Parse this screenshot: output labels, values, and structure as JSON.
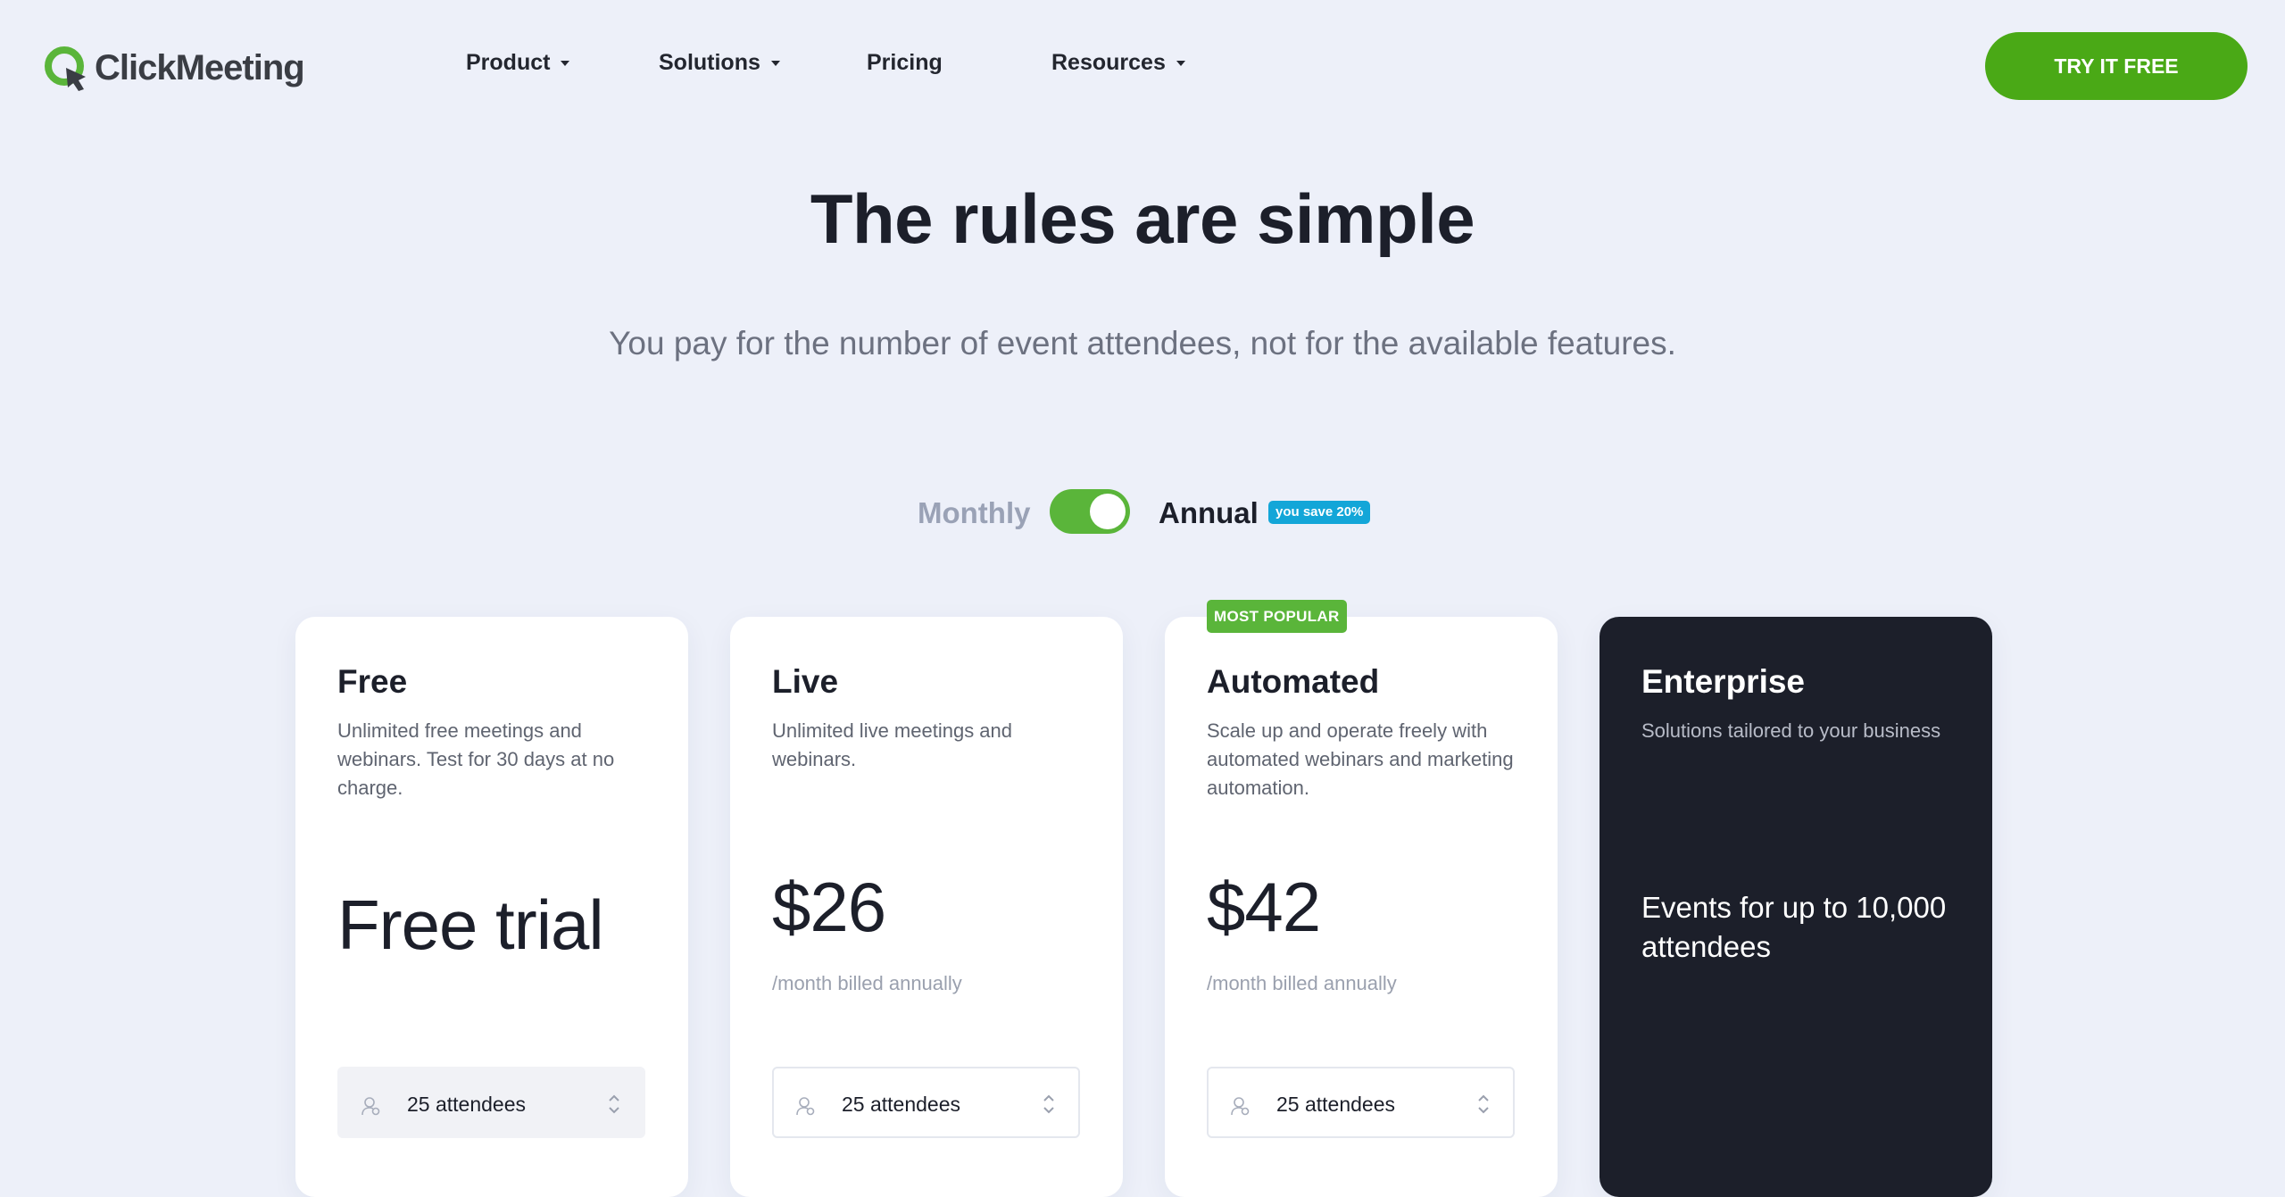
{
  "brand": {
    "name": "ClickMeeting",
    "accent": "#4aa916"
  },
  "nav": {
    "items": [
      {
        "label": "Product",
        "has_dropdown": true
      },
      {
        "label": "Solutions",
        "has_dropdown": true
      },
      {
        "label": "Pricing",
        "has_dropdown": false
      },
      {
        "label": "Resources",
        "has_dropdown": true
      }
    ],
    "cta_label": "TRY IT FREE"
  },
  "hero": {
    "title": "The rules are simple",
    "subtitle": "You pay for the number of event attendees, not for the available features."
  },
  "billing": {
    "monthly_label": "Monthly",
    "annual_label": "Annual",
    "save_badge": "you save 20%",
    "selected": "Annual"
  },
  "plans": [
    {
      "name": "Free",
      "description": "Unlimited free meetings and webinars. Test for 30 days at no charge.",
      "price": "Free trial",
      "period": "",
      "attendees": "25 attendees"
    },
    {
      "name": "Live",
      "description": "Unlimited live meetings and webinars.",
      "price": "$26",
      "period": "/month billed annually",
      "attendees": "25 attendees"
    },
    {
      "name": "Automated",
      "badge": "MOST POPULAR",
      "description": "Scale up and operate freely with automated webinars and marketing automation.",
      "price": "$42",
      "period": "/month billed annually",
      "attendees": "25 attendees"
    },
    {
      "name": "Enterprise",
      "description": "Solutions tailored to your business",
      "highlight": "Events for up to 10,000 attendees"
    }
  ]
}
